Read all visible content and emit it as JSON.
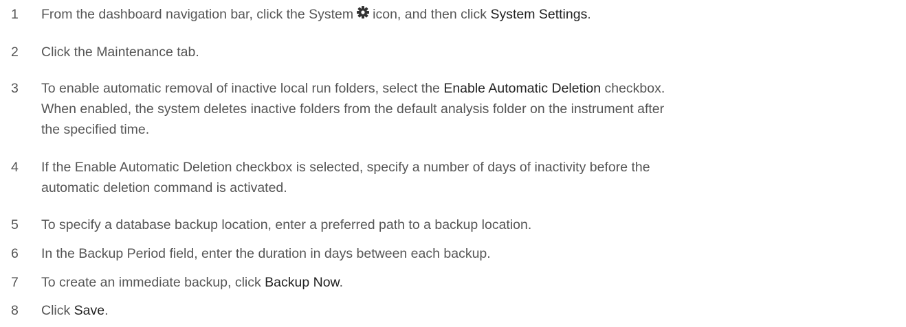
{
  "steps": [
    {
      "number": "1",
      "parts": {
        "a": "From the dashboard navigation bar, click the System",
        "icon": "gear-icon",
        "b": "icon, and then click",
        "c": "System Settings",
        "d": "."
      }
    },
    {
      "number": "2",
      "parts": {
        "a": "Click the Maintenance tab."
      }
    },
    {
      "number": "3",
      "parts": {
        "a": "To enable automatic removal of inactive local run folders, select the",
        "b": "Enable Automatic Deletion",
        "c": "checkbox.",
        "line2": "When enabled, the system deletes inactive folders from the default analysis folder on the instrument after",
        "line3": "the specified time."
      }
    },
    {
      "number": "4",
      "parts": {
        "line1": "If the Enable Automatic Deletion checkbox is selected, specify a number of days of inactivity before the",
        "line2": "automatic deletion command is activated."
      }
    },
    {
      "number": "5",
      "parts": {
        "a": "To specify a database backup location, enter a preferred path to a backup location."
      }
    },
    {
      "number": "6",
      "parts": {
        "a": "In the Backup Period field, enter the duration in days between each backup."
      }
    },
    {
      "number": "7",
      "parts": {
        "a": "To create an immediate backup, click",
        "b": "Backup Now",
        "c": "."
      }
    },
    {
      "number": "8",
      "parts": {
        "a": "Click",
        "b": "Save",
        "c": "."
      }
    }
  ],
  "colors": {
    "text": "#555555",
    "bold_text": "#222222"
  }
}
